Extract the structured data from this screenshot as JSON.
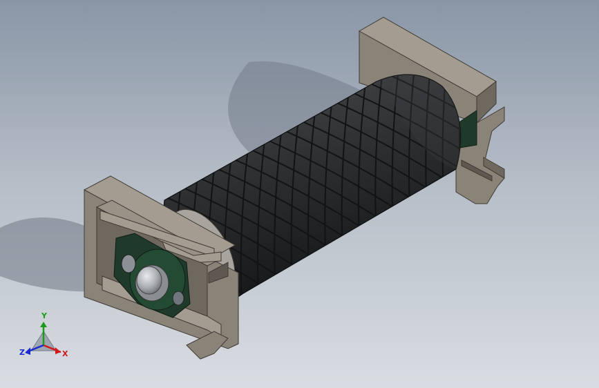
{
  "triad": {
    "x_label": "X",
    "y_label": "Y",
    "z_label": "Z",
    "x_color": "#d01818",
    "y_color": "#1a9a1a",
    "z_color": "#1a2ad0"
  },
  "colors": {
    "frame": "#8a8378",
    "frame_light": "#a49c90",
    "frame_dark": "#5e5850",
    "roller": "#2e2f31",
    "roller_dark": "#1a1b1c",
    "bearing": "#1f3a2a",
    "shaft": "#b9bcc0"
  },
  "model": {
    "component_icons": [
      "conveyor-roller-icon",
      "end-bracket-icon",
      "bearing-housing-icon"
    ]
  }
}
